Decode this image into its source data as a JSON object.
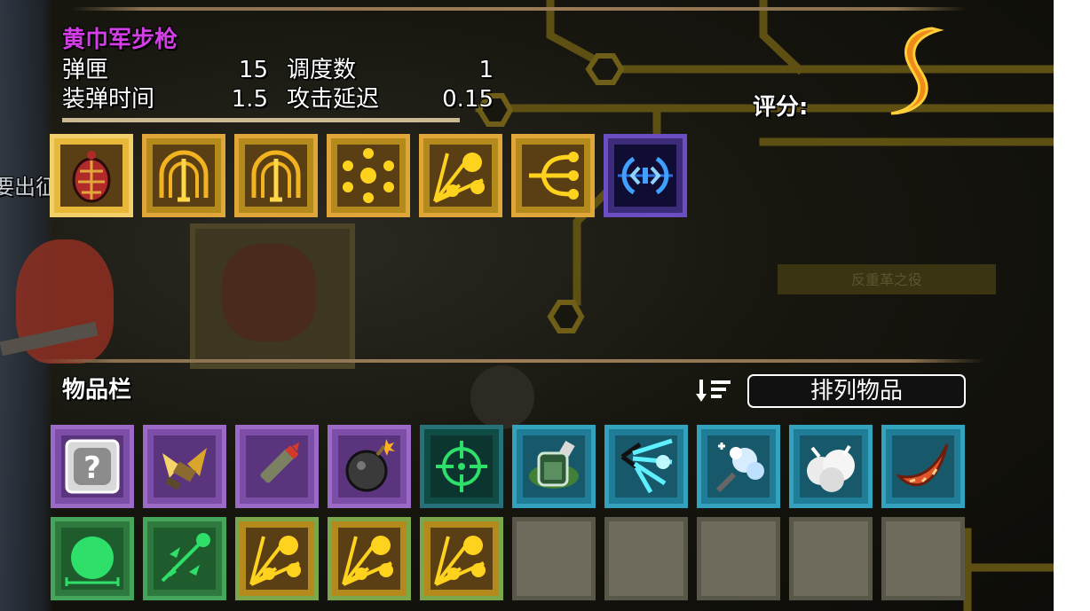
{
  "weapon": {
    "name": "黄巾军步枪",
    "stats": [
      {
        "label": "弹匣",
        "value": "15"
      },
      {
        "label": "调度数",
        "value": "1"
      },
      {
        "label": "装弹时间",
        "value": "1.5"
      },
      {
        "label": "攻击延迟",
        "value": "0.15"
      }
    ]
  },
  "rating": {
    "label": "评分:",
    "icon": "flame-s-icon"
  },
  "background": {
    "left_label": "要出征",
    "right_label": "反重革之役"
  },
  "equipped_slots": [
    {
      "icon": "turtle-shell-icon",
      "color": "gold",
      "selected": true
    },
    {
      "icon": "arc-bounce-icon",
      "color": "gold"
    },
    {
      "icon": "arc-bounce-icon",
      "color": "gold"
    },
    {
      "icon": "split-burst-icon",
      "color": "gold"
    },
    {
      "icon": "spray-shot-icon",
      "color": "gold"
    },
    {
      "icon": "triple-fork-icon",
      "color": "gold"
    },
    {
      "icon": "sound-wave-icon",
      "color": "blue"
    }
  ],
  "inventory": {
    "label": "物品栏",
    "sort_icon": "sort-icon",
    "sort_label": "排列物品",
    "items": [
      {
        "icon": "mystery-box-icon",
        "color": "purple"
      },
      {
        "icon": "golden-wings-icon",
        "color": "purple"
      },
      {
        "icon": "bullet-icon",
        "color": "purple"
      },
      {
        "icon": "bomb-icon",
        "color": "purple"
      },
      {
        "icon": "crosshair-icon",
        "color": "tealdk"
      },
      {
        "icon": "poison-flask-icon",
        "color": "teal"
      },
      {
        "icon": "lightning-dash-icon",
        "color": "teal"
      },
      {
        "icon": "frost-spray-icon",
        "color": "teal"
      },
      {
        "icon": "smoke-cloud-icon",
        "color": "teal"
      },
      {
        "icon": "boomerang-icon",
        "color": "teal"
      },
      {
        "icon": "green-orb-icon",
        "color": "green"
      },
      {
        "icon": "green-split-icon",
        "color": "green"
      },
      {
        "icon": "spray-shot-icon",
        "color": "goldinv"
      },
      {
        "icon": "spray-shot-icon",
        "color": "goldinv"
      },
      {
        "icon": "spray-shot-icon",
        "color": "goldinv"
      },
      {
        "icon": "",
        "color": "empty"
      },
      {
        "icon": "",
        "color": "empty"
      },
      {
        "icon": "",
        "color": "empty"
      },
      {
        "icon": "",
        "color": "empty"
      },
      {
        "icon": "",
        "color": "empty"
      }
    ]
  },
  "colors": {
    "title": "#d43ee6",
    "circuit": "#6b5a14",
    "gold": "#e8b83a"
  }
}
